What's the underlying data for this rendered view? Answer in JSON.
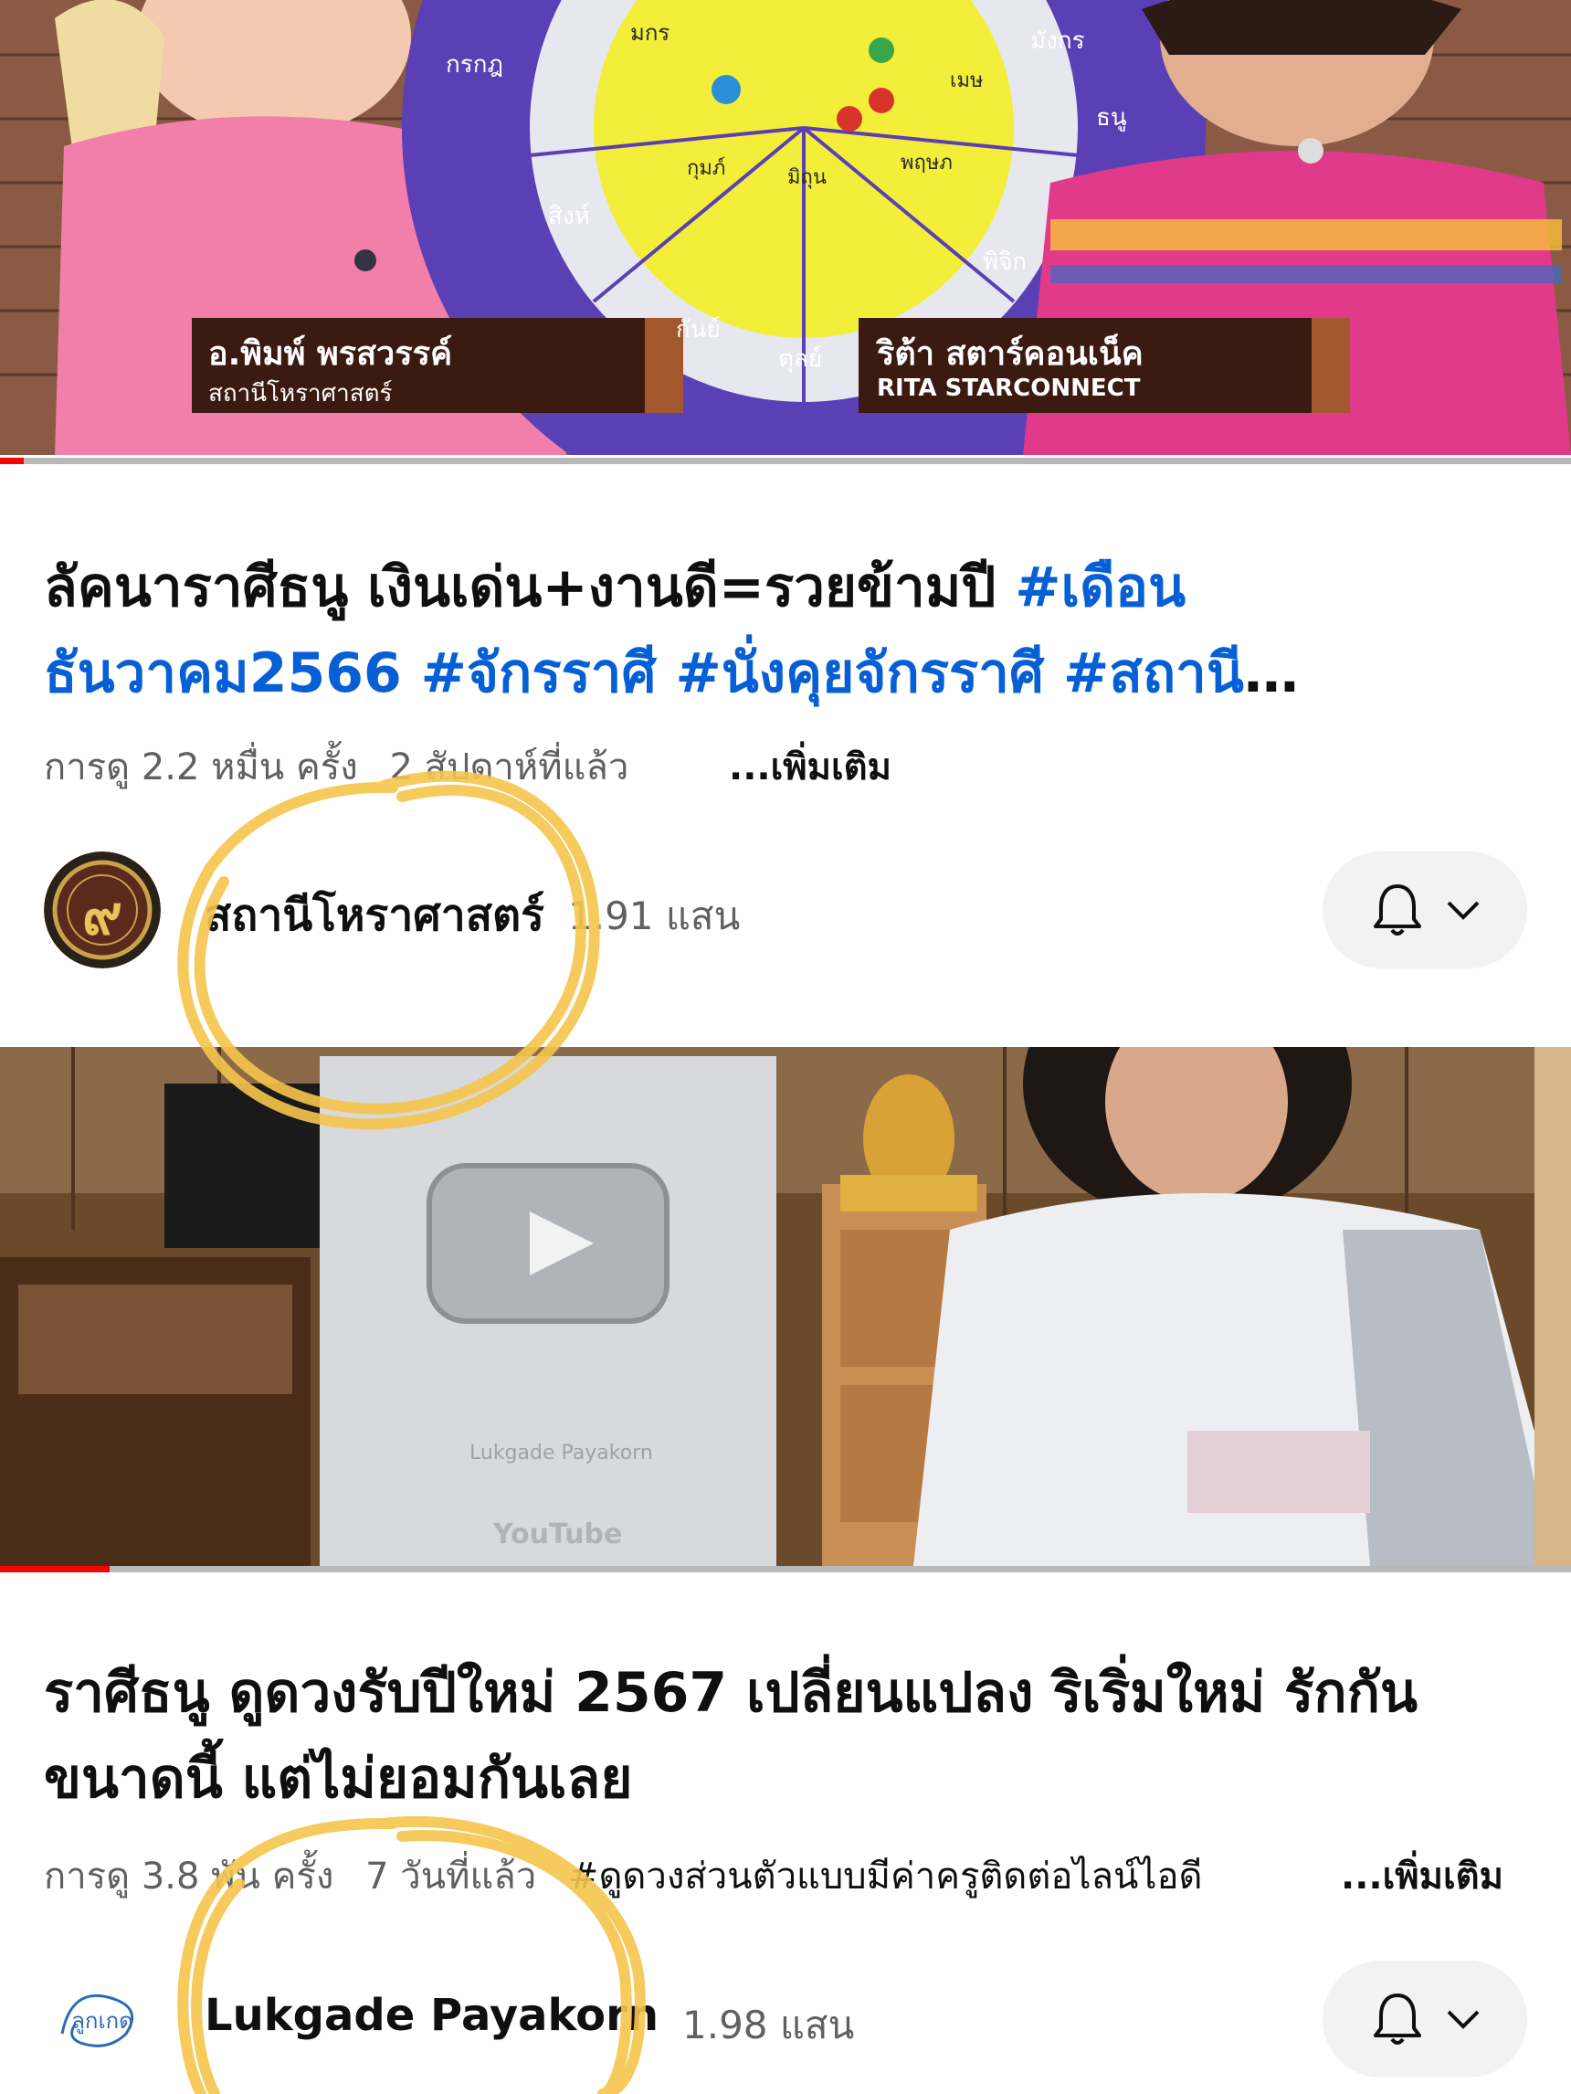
{
  "videos": [
    {
      "thumbnail_captions": {
        "left_name": "อ.พิมพ์ พรสวรรค์",
        "left_sub": "สถานีโหราศาสตร์",
        "right_name": "ริต้า สตาร์คอนเน็ค",
        "right_sub": "RITA STARCONNECT",
        "wheel_labels": [
          "กรกฎ",
          "มังกร",
          "ธนู",
          "พิจิก",
          "ตุลย์",
          "กันย์",
          "สิงห์",
          "มกร",
          "เมษ",
          "พฤษภ",
          "มิถุน",
          "กุมภ์"
        ]
      },
      "progress": 0.015,
      "title_plain": "ลัคนาราศีธนู เงินเด่น+งานดี=รวยข้ามปี ",
      "title_tags": "#เดือนธันวาคม2566 #จักรราศี #นั่งคุยจักรราศี #สถานีโหราศาสตร์",
      "views": "การดู 2.2 หมื่น ครั้ง",
      "age": "2 สัปดาห์ที่แล้ว",
      "more_label": "...เพิ่มเติม",
      "channel_name": "สถานีโหราศาสตร์",
      "subscribers": "1.91 แสน",
      "avatar_letter": "๙"
    },
    {
      "thumbnail_captions": {
        "award_text": "Lukgade Payakorn",
        "award_brand": "YouTube"
      },
      "progress": 0.07,
      "title_plain": "ราศีธนู ดูดวงรับปีใหม่ 2567 เปลี่ยนแปลง ริเริ่มใหม่ รักกันขนาดนี้ แต่ไม่ยอมกันเลย",
      "title_tags": "",
      "views": "การดู 3.8 พัน ครั้ง",
      "age": "7 วันที่แล้ว",
      "description_snippet": "#ดูดวงส่วนตัวแบบมีค่าครูติดต่อไลน์ไอดี",
      "more_label": "...เพิ่มเติม",
      "channel_name": "Lukgade Payakorn",
      "subscribers": "1.98 แสน",
      "avatar_letter": "ลูกเกด"
    }
  ],
  "colors": {
    "link_blue": "#065fd4",
    "progress_red": "#ff0000",
    "scribble_yellow": "#f6c54b"
  }
}
